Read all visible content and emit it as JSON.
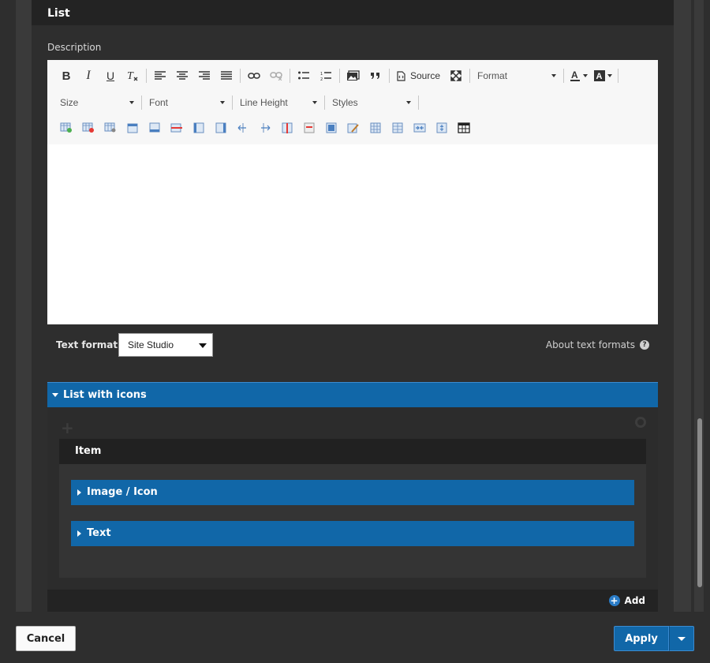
{
  "list_header": {
    "title": "List"
  },
  "description": {
    "label": "Description"
  },
  "editor": {
    "toolbar_row1": {
      "bold": "B",
      "italic": "I",
      "underline": "U",
      "remove_format": "Tx",
      "source_label": "Source",
      "format_label": "Format"
    },
    "toolbar_row2": {
      "size_label": "Size",
      "font_label": "Font",
      "line_height_label": "Line Height",
      "styles_label": "Styles"
    },
    "content": ""
  },
  "text_format": {
    "label": "Text format",
    "selected": "Site Studio",
    "about_link": "About text formats",
    "help_glyph": "?"
  },
  "list_with_icons": {
    "title": "List with icons",
    "item": {
      "title": "Item",
      "sections": [
        {
          "label": "Image / Icon"
        },
        {
          "label": "Text"
        }
      ]
    },
    "add_label": "Add",
    "add_glyph": "+"
  },
  "footer": {
    "cancel_label": "Cancel",
    "apply_label": "Apply"
  },
  "colors": {
    "accent_blue": "#1167a8",
    "dark_bg": "#2e2e2e",
    "header_bg": "#232323",
    "toolbar_bg": "#f7f7f7"
  }
}
